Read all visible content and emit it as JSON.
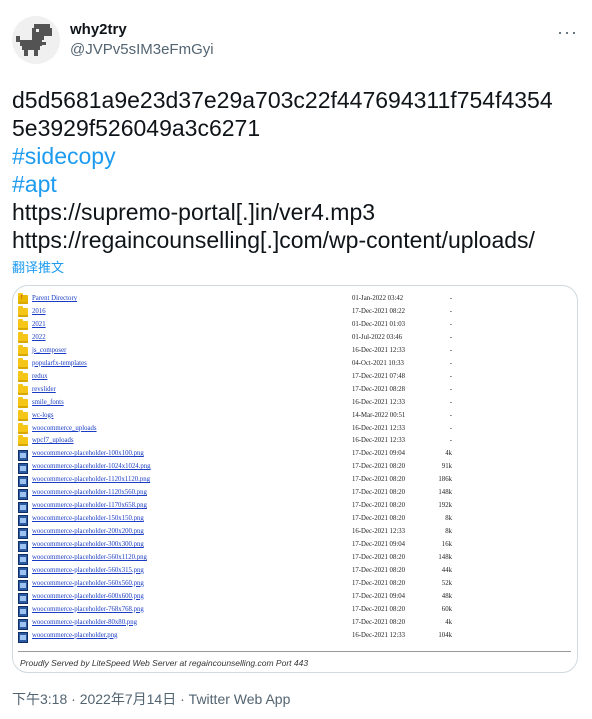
{
  "user": {
    "display_name": "why2try",
    "handle": "@JVPv5sIM3eFmGyi"
  },
  "more_label": "···",
  "tweet": {
    "lines": [
      "d5d5681a9e23d37e29a703c22f447694311f754f4354",
      "5e3929f526049a3c6271"
    ],
    "hashtags": [
      "#sidecopy",
      "#apt"
    ],
    "urls": [
      "https://supremo-portal[.]in/ver4.mp3",
      "https://regaincounselling[.]com/wp-content/uploads/"
    ],
    "translate_label": "翻译推文"
  },
  "directory": {
    "rows": [
      {
        "name": "Parent Directory",
        "date": "01-Jan-2022 03:42",
        "size": "-",
        "icon": "parent"
      },
      {
        "name": "2016",
        "date": "17-Dec-2021 08:22",
        "size": "-",
        "icon": "folder"
      },
      {
        "name": "2021",
        "date": "01-Dec-2021 01:03",
        "size": "-",
        "icon": "folder"
      },
      {
        "name": "2022",
        "date": "01-Jul-2022 03:46",
        "size": "-",
        "icon": "folder"
      },
      {
        "name": "js_composer",
        "date": "16-Dec-2021 12:33",
        "size": "-",
        "icon": "folder"
      },
      {
        "name": "popularfx-templates",
        "date": "04-Oct-2021 10:33",
        "size": "-",
        "icon": "folder"
      },
      {
        "name": "redux",
        "date": "17-Dec-2021 07:48",
        "size": "-",
        "icon": "folder"
      },
      {
        "name": "revslider",
        "date": "17-Dec-2021 08:28",
        "size": "-",
        "icon": "folder"
      },
      {
        "name": "smile_fonts",
        "date": "16-Dec-2021 12:33",
        "size": "-",
        "icon": "folder"
      },
      {
        "name": "wc-logs",
        "date": "14-Mar-2022 00:51",
        "size": "-",
        "icon": "folder"
      },
      {
        "name": "woocommerce_uploads",
        "date": "16-Dec-2021 12:33",
        "size": "-",
        "icon": "folder"
      },
      {
        "name": "wpcf7_uploads",
        "date": "16-Dec-2021 12:33",
        "size": "-",
        "icon": "folder"
      },
      {
        "name": "woocommerce-placeholder-100x100.png",
        "date": "17-Dec-2021 09:04",
        "size": "4k",
        "icon": "file"
      },
      {
        "name": "woocommerce-placeholder-1024x1024.png",
        "date": "17-Dec-2021 08:20",
        "size": "91k",
        "icon": "file"
      },
      {
        "name": "woocommerce-placeholder-1120x1120.png",
        "date": "17-Dec-2021 08:20",
        "size": "186k",
        "icon": "file"
      },
      {
        "name": "woocommerce-placeholder-1120x560.png",
        "date": "17-Dec-2021 08:20",
        "size": "148k",
        "icon": "file"
      },
      {
        "name": "woocommerce-placeholder-1170x658.png",
        "date": "17-Dec-2021 08:20",
        "size": "192k",
        "icon": "file"
      },
      {
        "name": "woocommerce-placeholder-150x150.png",
        "date": "17-Dec-2021 08:20",
        "size": "8k",
        "icon": "file"
      },
      {
        "name": "woocommerce-placeholder-200x200.png",
        "date": "16-Dec-2021 12:33",
        "size": "8k",
        "icon": "file"
      },
      {
        "name": "woocommerce-placeholder-300x300.png",
        "date": "17-Dec-2021 09:04",
        "size": "16k",
        "icon": "file"
      },
      {
        "name": "woocommerce-placeholder-560x1120.png",
        "date": "17-Dec-2021 08:20",
        "size": "148k",
        "icon": "file"
      },
      {
        "name": "woocommerce-placeholder-560x315.png",
        "date": "17-Dec-2021 08:20",
        "size": "44k",
        "icon": "file"
      },
      {
        "name": "woocommerce-placeholder-560x560.png",
        "date": "17-Dec-2021 08:20",
        "size": "52k",
        "icon": "file"
      },
      {
        "name": "woocommerce-placeholder-600x600.png",
        "date": "17-Dec-2021 09:04",
        "size": "48k",
        "icon": "file"
      },
      {
        "name": "woocommerce-placeholder-768x768.png",
        "date": "17-Dec-2021 08:20",
        "size": "60k",
        "icon": "file"
      },
      {
        "name": "woocommerce-placeholder-80x80.png",
        "date": "17-Dec-2021 08:20",
        "size": "4k",
        "icon": "file"
      },
      {
        "name": "woocommerce-placeholder.png",
        "date": "16-Dec-2021 12:33",
        "size": "104k",
        "icon": "file"
      }
    ],
    "footer": "Proudly Served by LiteSpeed Web Server at regaincounselling.com Port 443"
  },
  "meta": {
    "time": "下午3:18",
    "separator1": " · ",
    "date": "2022年7月14日",
    "separator2": " · ",
    "source": "Twitter Web App"
  },
  "colors": {
    "link_blue": "#1d9bf0",
    "text": "#0f1419",
    "muted": "#536471"
  }
}
